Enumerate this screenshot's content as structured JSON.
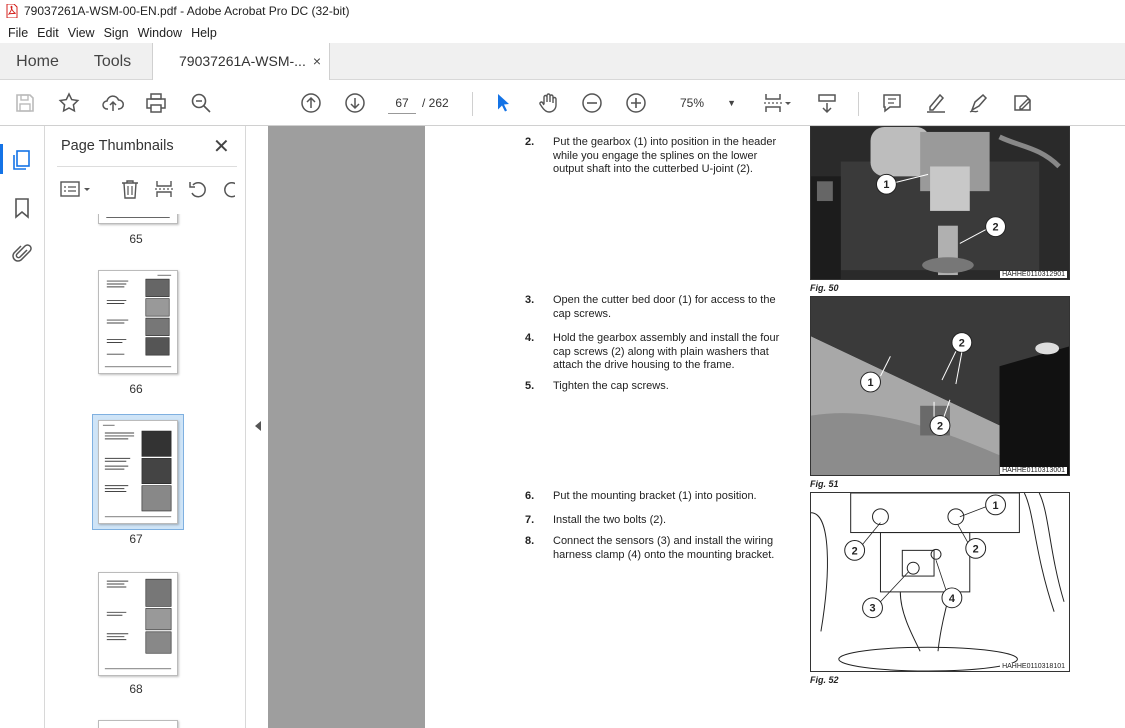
{
  "window": {
    "title": "79037261A-WSM-00-EN.pdf - Adobe Acrobat Pro DC (32-bit)"
  },
  "menu": [
    "File",
    "Edit",
    "View",
    "Sign",
    "Window",
    "Help"
  ],
  "tabs": {
    "home": "Home",
    "tools": "Tools",
    "doc": "79037261A-WSM-...",
    "close": "×"
  },
  "toolbar": {
    "page_current": "67",
    "page_total": "/ 262",
    "zoom": "75%"
  },
  "thumbnails": {
    "title": "Page Thumbnails",
    "close": "✕",
    "pages": [
      {
        "num": "65"
      },
      {
        "num": "66"
      },
      {
        "num": "67",
        "selected": true
      },
      {
        "num": "68"
      }
    ]
  },
  "document": {
    "steps": [
      {
        "num": "2.",
        "text": "Put the gearbox (1) into position in the header while you engage the splines on the lower output shaft into the cutterbed U-joint (2)."
      },
      {
        "num": "3.",
        "text": "Open the cutter bed door (1) for access to the cap screws."
      },
      {
        "num": "4.",
        "text": "Hold the gearbox assembly and install the four cap screws (2) along with plain washers that attach the drive housing to the frame."
      },
      {
        "num": "5.",
        "text": "Tighten the cap screws."
      },
      {
        "num": "6.",
        "text": "Put the mounting bracket (1) into position."
      },
      {
        "num": "7.",
        "text": "Install the two bolts (2)."
      },
      {
        "num": "8.",
        "text": "Connect the sensors (3) and install the wiring harness clamp (4) onto the mounting bracket."
      }
    ],
    "figures": [
      {
        "caption": "Fig. 50",
        "code": "HAHHE0110312901",
        "callouts": [
          "1",
          "2"
        ]
      },
      {
        "caption": "Fig. 51",
        "code": "HAHHE0110313001",
        "callouts": [
          "1",
          "2",
          "2"
        ]
      },
      {
        "caption": "Fig. 52",
        "code": "HAHHE0110318101",
        "callouts": [
          "1",
          "2",
          "2",
          "3",
          "4"
        ]
      }
    ]
  }
}
